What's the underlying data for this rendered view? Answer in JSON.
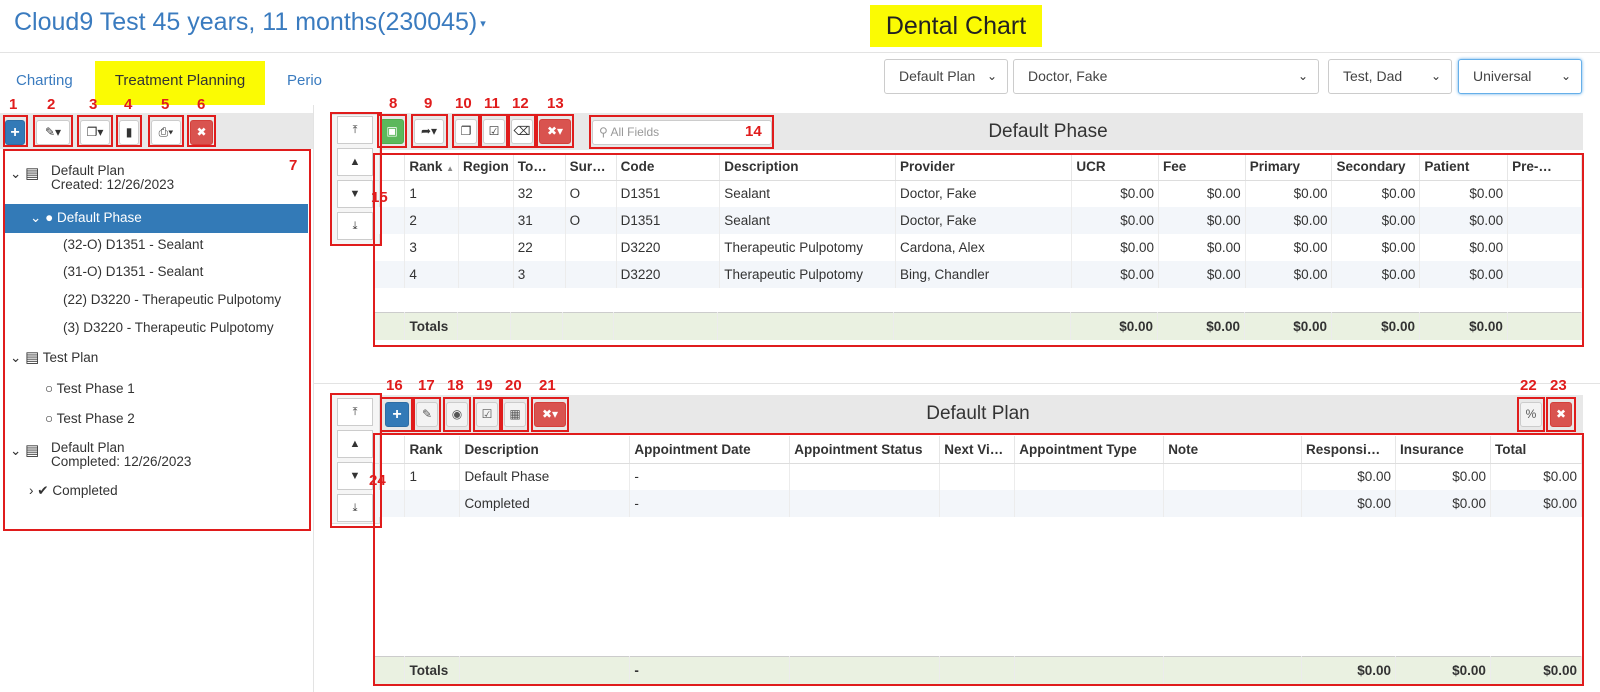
{
  "header": {
    "title": "Cloud9 Test 45 years, 11 months(230045)",
    "title_caret": "▾",
    "chart_label": "Dental Chart"
  },
  "tabs": [
    {
      "label": "Charting"
    },
    {
      "label": "Treatment Planning"
    },
    {
      "label": "Perio"
    }
  ],
  "selects": {
    "plan": "Default Plan",
    "doctor": "Doctor, Fake",
    "responsible": "Test, Dad",
    "numbering": "Universal"
  },
  "icons": {
    "chevron": "chevron-down-icon"
  },
  "callouts": [
    "1",
    "2",
    "3",
    "4",
    "5",
    "6",
    "7",
    "8",
    "9",
    "10",
    "11",
    "12",
    "13",
    "14",
    "15",
    "16",
    "17",
    "18",
    "19",
    "20",
    "21",
    "22",
    "23",
    "24"
  ],
  "tree": {
    "plan1": {
      "name": "Default Plan",
      "created": "Created: 12/26/2023"
    },
    "phase1": {
      "name": "Default Phase"
    },
    "items": [
      "(32-O) D1351 - Sealant",
      "(31-O) D1351 - Sealant",
      "(22) D3220 - Therapeutic Pulpotomy",
      "(3) D3220 - Therapeutic Pulpotomy"
    ],
    "plan2": {
      "name": "Test Plan"
    },
    "phases2": [
      "Test Phase 1",
      "Test Phase 2"
    ],
    "plan3": {
      "name": "Default Plan",
      "completed": "Completed: 12/26/2023"
    },
    "completed": "Completed"
  },
  "phase_panel": {
    "title": "Default Phase",
    "search_placeholder": "All Fields",
    "columns": [
      "Rank",
      "Region",
      "To…",
      "Sur…",
      "Code",
      "Description",
      "Provider",
      "UCR",
      "Fee",
      "Primary",
      "Secondary",
      "Patient",
      "Pre-…"
    ],
    "rows": [
      [
        "1",
        "",
        "32",
        "O",
        "D1351",
        "Sealant",
        "Doctor, Fake",
        "$0.00",
        "$0.00",
        "$0.00",
        "$0.00",
        "$0.00",
        ""
      ],
      [
        "2",
        "",
        "31",
        "O",
        "D1351",
        "Sealant",
        "Doctor, Fake",
        "$0.00",
        "$0.00",
        "$0.00",
        "$0.00",
        "$0.00",
        ""
      ],
      [
        "3",
        "",
        "22",
        "",
        "D3220",
        "Therapeutic Pulpotomy",
        "Cardona, Alex",
        "$0.00",
        "$0.00",
        "$0.00",
        "$0.00",
        "$0.00",
        ""
      ],
      [
        "4",
        "",
        "3",
        "",
        "D3220",
        "Therapeutic Pulpotomy",
        "Bing, Chandler",
        "$0.00",
        "$0.00",
        "$0.00",
        "$0.00",
        "$0.00",
        ""
      ]
    ],
    "totals": {
      "label": "Totals",
      "ucr": "$0.00",
      "fee": "$0.00",
      "primary": "$0.00",
      "secondary": "$0.00",
      "patient": "$0.00"
    }
  },
  "plan_panel": {
    "title": "Default Plan",
    "columns": [
      "Rank",
      "Description",
      "Appointment Date",
      "Appointment Status",
      "Next Vi…",
      "Appointment Type",
      "Note",
      "Responsi…",
      "Insurance",
      "Total"
    ],
    "rows": [
      [
        "1",
        "Default Phase",
        "-",
        "",
        "",
        "",
        "",
        "$0.00",
        "$0.00",
        "$0.00"
      ],
      [
        "",
        "Completed",
        "-",
        "",
        "",
        "",
        "",
        "$0.00",
        "$0.00",
        "$0.00"
      ]
    ],
    "totals": {
      "label": "Totals",
      "date": "-",
      "responsible": "$0.00",
      "insurance": "$0.00",
      "total": "$0.00"
    }
  }
}
